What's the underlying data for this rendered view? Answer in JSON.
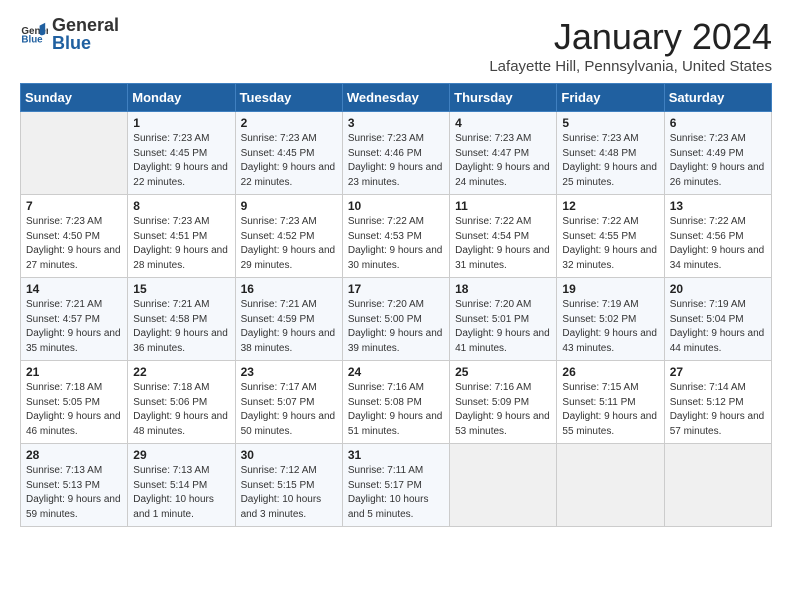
{
  "logo": {
    "general": "General",
    "blue": "Blue"
  },
  "title": {
    "month": "January 2024",
    "location": "Lafayette Hill, Pennsylvania, United States"
  },
  "days_of_week": [
    "Sunday",
    "Monday",
    "Tuesday",
    "Wednesday",
    "Thursday",
    "Friday",
    "Saturday"
  ],
  "weeks": [
    [
      {
        "day": "",
        "sunrise": "",
        "sunset": "",
        "daylight": ""
      },
      {
        "day": "1",
        "sunrise": "Sunrise: 7:23 AM",
        "sunset": "Sunset: 4:45 PM",
        "daylight": "Daylight: 9 hours and 22 minutes."
      },
      {
        "day": "2",
        "sunrise": "Sunrise: 7:23 AM",
        "sunset": "Sunset: 4:45 PM",
        "daylight": "Daylight: 9 hours and 22 minutes."
      },
      {
        "day": "3",
        "sunrise": "Sunrise: 7:23 AM",
        "sunset": "Sunset: 4:46 PM",
        "daylight": "Daylight: 9 hours and 23 minutes."
      },
      {
        "day": "4",
        "sunrise": "Sunrise: 7:23 AM",
        "sunset": "Sunset: 4:47 PM",
        "daylight": "Daylight: 9 hours and 24 minutes."
      },
      {
        "day": "5",
        "sunrise": "Sunrise: 7:23 AM",
        "sunset": "Sunset: 4:48 PM",
        "daylight": "Daylight: 9 hours and 25 minutes."
      },
      {
        "day": "6",
        "sunrise": "Sunrise: 7:23 AM",
        "sunset": "Sunset: 4:49 PM",
        "daylight": "Daylight: 9 hours and 26 minutes."
      }
    ],
    [
      {
        "day": "7",
        "sunrise": "Sunrise: 7:23 AM",
        "sunset": "Sunset: 4:50 PM",
        "daylight": "Daylight: 9 hours and 27 minutes."
      },
      {
        "day": "8",
        "sunrise": "Sunrise: 7:23 AM",
        "sunset": "Sunset: 4:51 PM",
        "daylight": "Daylight: 9 hours and 28 minutes."
      },
      {
        "day": "9",
        "sunrise": "Sunrise: 7:23 AM",
        "sunset": "Sunset: 4:52 PM",
        "daylight": "Daylight: 9 hours and 29 minutes."
      },
      {
        "day": "10",
        "sunrise": "Sunrise: 7:22 AM",
        "sunset": "Sunset: 4:53 PM",
        "daylight": "Daylight: 9 hours and 30 minutes."
      },
      {
        "day": "11",
        "sunrise": "Sunrise: 7:22 AM",
        "sunset": "Sunset: 4:54 PM",
        "daylight": "Daylight: 9 hours and 31 minutes."
      },
      {
        "day": "12",
        "sunrise": "Sunrise: 7:22 AM",
        "sunset": "Sunset: 4:55 PM",
        "daylight": "Daylight: 9 hours and 32 minutes."
      },
      {
        "day": "13",
        "sunrise": "Sunrise: 7:22 AM",
        "sunset": "Sunset: 4:56 PM",
        "daylight": "Daylight: 9 hours and 34 minutes."
      }
    ],
    [
      {
        "day": "14",
        "sunrise": "Sunrise: 7:21 AM",
        "sunset": "Sunset: 4:57 PM",
        "daylight": "Daylight: 9 hours and 35 minutes."
      },
      {
        "day": "15",
        "sunrise": "Sunrise: 7:21 AM",
        "sunset": "Sunset: 4:58 PM",
        "daylight": "Daylight: 9 hours and 36 minutes."
      },
      {
        "day": "16",
        "sunrise": "Sunrise: 7:21 AM",
        "sunset": "Sunset: 4:59 PM",
        "daylight": "Daylight: 9 hours and 38 minutes."
      },
      {
        "day": "17",
        "sunrise": "Sunrise: 7:20 AM",
        "sunset": "Sunset: 5:00 PM",
        "daylight": "Daylight: 9 hours and 39 minutes."
      },
      {
        "day": "18",
        "sunrise": "Sunrise: 7:20 AM",
        "sunset": "Sunset: 5:01 PM",
        "daylight": "Daylight: 9 hours and 41 minutes."
      },
      {
        "day": "19",
        "sunrise": "Sunrise: 7:19 AM",
        "sunset": "Sunset: 5:02 PM",
        "daylight": "Daylight: 9 hours and 43 minutes."
      },
      {
        "day": "20",
        "sunrise": "Sunrise: 7:19 AM",
        "sunset": "Sunset: 5:04 PM",
        "daylight": "Daylight: 9 hours and 44 minutes."
      }
    ],
    [
      {
        "day": "21",
        "sunrise": "Sunrise: 7:18 AM",
        "sunset": "Sunset: 5:05 PM",
        "daylight": "Daylight: 9 hours and 46 minutes."
      },
      {
        "day": "22",
        "sunrise": "Sunrise: 7:18 AM",
        "sunset": "Sunset: 5:06 PM",
        "daylight": "Daylight: 9 hours and 48 minutes."
      },
      {
        "day": "23",
        "sunrise": "Sunrise: 7:17 AM",
        "sunset": "Sunset: 5:07 PM",
        "daylight": "Daylight: 9 hours and 50 minutes."
      },
      {
        "day": "24",
        "sunrise": "Sunrise: 7:16 AM",
        "sunset": "Sunset: 5:08 PM",
        "daylight": "Daylight: 9 hours and 51 minutes."
      },
      {
        "day": "25",
        "sunrise": "Sunrise: 7:16 AM",
        "sunset": "Sunset: 5:09 PM",
        "daylight": "Daylight: 9 hours and 53 minutes."
      },
      {
        "day": "26",
        "sunrise": "Sunrise: 7:15 AM",
        "sunset": "Sunset: 5:11 PM",
        "daylight": "Daylight: 9 hours and 55 minutes."
      },
      {
        "day": "27",
        "sunrise": "Sunrise: 7:14 AM",
        "sunset": "Sunset: 5:12 PM",
        "daylight": "Daylight: 9 hours and 57 minutes."
      }
    ],
    [
      {
        "day": "28",
        "sunrise": "Sunrise: 7:13 AM",
        "sunset": "Sunset: 5:13 PM",
        "daylight": "Daylight: 9 hours and 59 minutes."
      },
      {
        "day": "29",
        "sunrise": "Sunrise: 7:13 AM",
        "sunset": "Sunset: 5:14 PM",
        "daylight": "Daylight: 10 hours and 1 minute."
      },
      {
        "day": "30",
        "sunrise": "Sunrise: 7:12 AM",
        "sunset": "Sunset: 5:15 PM",
        "daylight": "Daylight: 10 hours and 3 minutes."
      },
      {
        "day": "31",
        "sunrise": "Sunrise: 7:11 AM",
        "sunset": "Sunset: 5:17 PM",
        "daylight": "Daylight: 10 hours and 5 minutes."
      },
      {
        "day": "",
        "sunrise": "",
        "sunset": "",
        "daylight": ""
      },
      {
        "day": "",
        "sunrise": "",
        "sunset": "",
        "daylight": ""
      },
      {
        "day": "",
        "sunrise": "",
        "sunset": "",
        "daylight": ""
      }
    ]
  ]
}
